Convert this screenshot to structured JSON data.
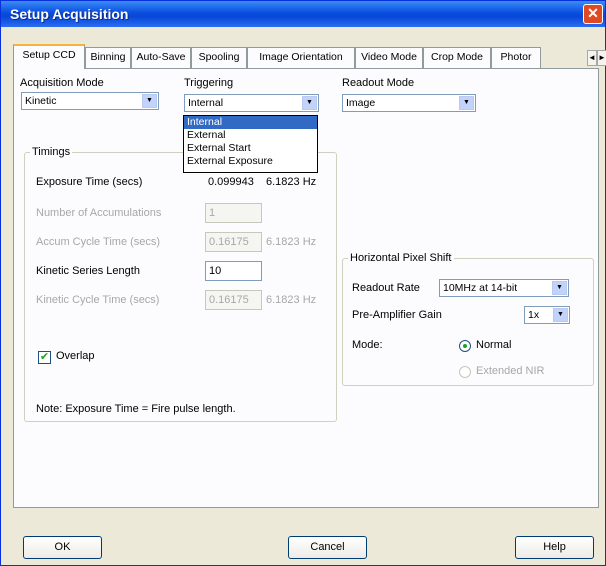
{
  "window": {
    "title": "Setup Acquisition",
    "close_glyph": "✕"
  },
  "tabs": [
    {
      "label": "Setup CCD"
    },
    {
      "label": "Binning"
    },
    {
      "label": "Auto-Save"
    },
    {
      "label": "Spooling"
    },
    {
      "label": "Image Orientation"
    },
    {
      "label": "Video Mode"
    },
    {
      "label": "Crop Mode"
    },
    {
      "label": "Photor"
    }
  ],
  "tab_scroll": {
    "left": "◄",
    "right": "►"
  },
  "acquisition_mode": {
    "label": "Acquisition Mode",
    "value": "Kinetic"
  },
  "triggering": {
    "label": "Triggering",
    "value": "Internal",
    "options": [
      "Internal",
      "External",
      "External Start",
      "External Exposure"
    ],
    "selected_index": 0
  },
  "readout_mode": {
    "label": "Readout Mode",
    "value": "Image"
  },
  "timings": {
    "title": "Timings",
    "exposure_label": "Exposure Time (secs)",
    "exposure_value": "0.099943",
    "exposure_hz": "6.1823 Hz",
    "accumulations_label": "Number of Accumulations",
    "accumulations_value": "1",
    "accum_cycle_label": "Accum Cycle Time (secs)",
    "accum_cycle_value": "0.16175",
    "accum_cycle_hz": "6.1823 Hz",
    "series_length_label": "Kinetic Series Length",
    "series_length_value": "10",
    "kinetic_cycle_label": "Kinetic Cycle Time (secs)",
    "kinetic_cycle_value": "0.16175",
    "kinetic_cycle_hz": "6.1823 Hz",
    "overlap_label": "Overlap",
    "overlap_checked": true,
    "note": "Note: Exposure Time = Fire pulse length."
  },
  "pixel_shift": {
    "title": "Horizontal Pixel Shift",
    "readout_rate_label": "Readout Rate",
    "readout_rate_value": "10MHz at 14-bit",
    "preamp_label": "Pre-Amplifier Gain",
    "preamp_value": "1x",
    "mode_label": "Mode:",
    "mode_normal": "Normal",
    "mode_extended": "Extended NIR",
    "mode_selected": "Normal"
  },
  "buttons": {
    "ok": "OK",
    "cancel": "Cancel",
    "help": "Help"
  },
  "icons": {
    "dropdown": "▼",
    "check": "✔"
  }
}
